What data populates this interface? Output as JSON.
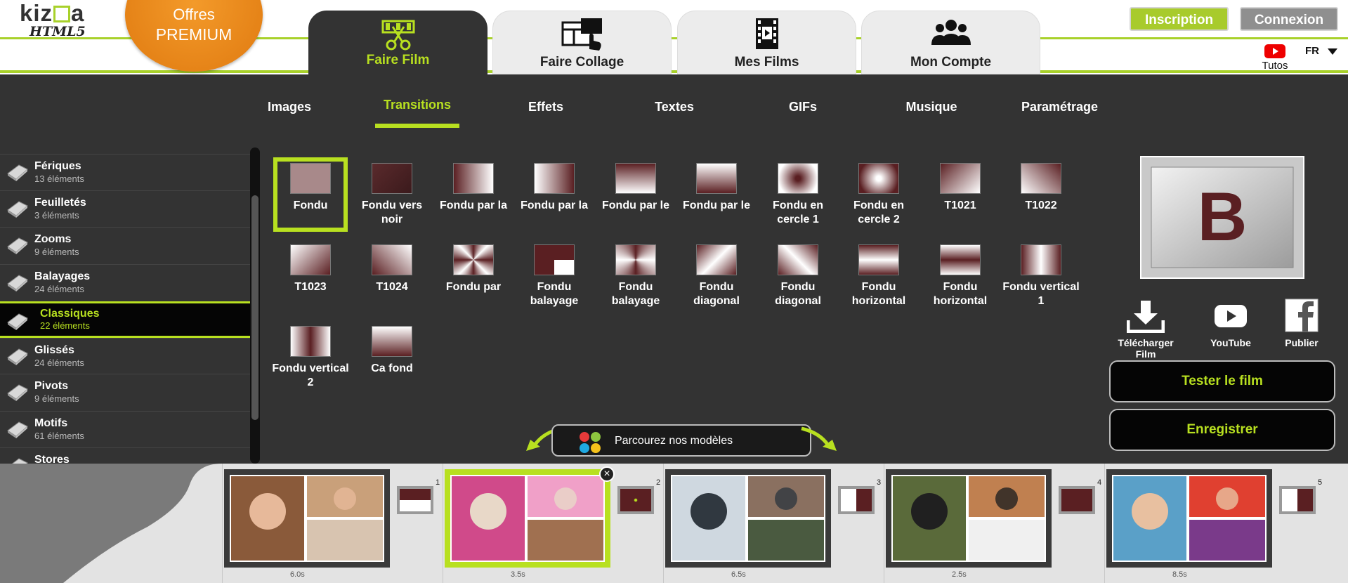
{
  "brand": {
    "logo_top": "kiz",
    "logo_top2": "a",
    "logo_sub": "HTML5",
    "premium_line1": "Offres",
    "premium_line2": "PREMIUM"
  },
  "main_tabs": [
    {
      "label": "Faire Film",
      "icon": "scissors-film-icon",
      "active": true
    },
    {
      "label": "Faire Collage",
      "icon": "collage-icon",
      "active": false
    },
    {
      "label": "Mes Films",
      "icon": "film-icon",
      "active": false
    },
    {
      "label": "Mon Compte",
      "icon": "users-icon",
      "active": false
    }
  ],
  "header": {
    "signup": "Inscription",
    "login": "Connexion",
    "tutos": "Tutos",
    "lang": "FR"
  },
  "sub_tabs": [
    "Images",
    "Transitions",
    "Effets",
    "Textes",
    "GIFs",
    "Musique",
    "Paramétrage"
  ],
  "categories": [
    {
      "name": "Fériques",
      "count": "13 éléments"
    },
    {
      "name": "Feuilletés",
      "count": "3 éléments"
    },
    {
      "name": "Zooms",
      "count": "9 éléments"
    },
    {
      "name": "Balayages",
      "count": "24 éléments"
    },
    {
      "name": "Classiques",
      "count": "22 éléments",
      "active": true
    },
    {
      "name": "Glissés",
      "count": "24 éléments"
    },
    {
      "name": "Pivots",
      "count": "9 éléments"
    },
    {
      "name": "Motifs",
      "count": "61 éléments"
    },
    {
      "name": "Stores",
      "count": ""
    }
  ],
  "transitions": [
    {
      "label": "Fondu",
      "style": "fade"
    },
    {
      "label": "Fondu vers noir",
      "style": "dark"
    },
    {
      "label": "Fondu par la",
      "style": "lr"
    },
    {
      "label": "Fondu par la",
      "style": "rl"
    },
    {
      "label": "Fondu par le",
      "style": "tb"
    },
    {
      "label": "Fondu par le",
      "style": "bt"
    },
    {
      "label": "Fondu en cercle 1",
      "style": "circ1"
    },
    {
      "label": "Fondu en cercle 2",
      "style": "circ2"
    },
    {
      "label": "T1021",
      "style": "diag1"
    },
    {
      "label": "T1022",
      "style": "diag2"
    },
    {
      "label": "T1023",
      "style": "diag3"
    },
    {
      "label": "T1024",
      "style": "diag4"
    },
    {
      "label": "Fondu par",
      "style": "radial"
    },
    {
      "label": "Fondu balayage",
      "style": "quad"
    },
    {
      "label": "Fondu balayage",
      "style": "quad2"
    },
    {
      "label": "Fondu diagonal",
      "style": "band1"
    },
    {
      "label": "Fondu diagonal",
      "style": "band2"
    },
    {
      "label": "Fondu horizontal",
      "style": "hband"
    },
    {
      "label": "Fondu horizontal",
      "style": "hband2"
    },
    {
      "label": "Fondu vertical 1",
      "style": "vband"
    },
    {
      "label": "Fondu vertical 2",
      "style": "vband2"
    },
    {
      "label": "Ca fond",
      "style": "tb2"
    }
  ],
  "modeles_label": "Parcourez nos modèles",
  "share": {
    "download": "Télécharger Film",
    "youtube": "YouTube",
    "publish": "Publier"
  },
  "actions": {
    "test": "Tester le film",
    "save": "Enregistrer"
  },
  "preview_letter": "B",
  "timeline": [
    {
      "num": "1",
      "duration": "6.0s"
    },
    {
      "num": "2",
      "duration": "3.5s",
      "selected": true
    },
    {
      "num": "3",
      "duration": "6.5s"
    },
    {
      "num": "4",
      "duration": "2.5s"
    },
    {
      "num": "5",
      "duration": "8.5s"
    }
  ],
  "colors": {
    "accent": "#b8e020",
    "dark": "#333333",
    "premium": "#e88a18",
    "maroon": "#5a1f22"
  }
}
